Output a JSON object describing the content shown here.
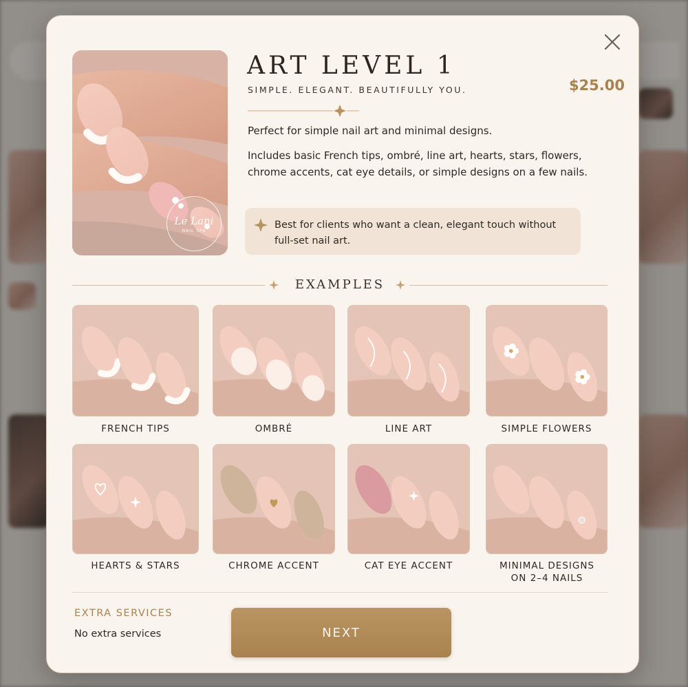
{
  "colors": {
    "accent_gold": "#a9834f",
    "modal_bg": "#faf4ee",
    "note_bg": "#f1e4d6",
    "text_dark": "#2e2823"
  },
  "modal": {
    "close_icon": "close-icon",
    "hero_logo": {
      "name": "Le Lani",
      "sub": "NAIL SPA"
    },
    "title": "ART LEVEL 1",
    "tagline": "SIMPLE. ELEGANT. BEAUTIFULLY YOU.",
    "price": "$25.00",
    "description_short": "Perfect for simple nail art and minimal designs.",
    "description_long": "Includes basic French tips, ombré, line art, hearts, stars, flowers, chrome accents, cat eye details, or simple designs on a few nails.",
    "note": {
      "icon": "sparkle-icon",
      "text": "Best for clients who want a clean, elegant touch without full-set nail art."
    },
    "examples_heading": "EXAMPLES",
    "examples": [
      {
        "label": "FRENCH TIPS",
        "style": "french"
      },
      {
        "label": "OMBRÉ",
        "style": "ombre"
      },
      {
        "label": "LINE ART",
        "style": "lineart"
      },
      {
        "label": "SIMPLE FLOWERS",
        "style": "flowers"
      },
      {
        "label": "HEARTS & STARS",
        "style": "hearts"
      },
      {
        "label": "CHROME ACCENT",
        "style": "chrome"
      },
      {
        "label": "CAT EYE ACCENT",
        "style": "cateye"
      },
      {
        "label": "MINIMAL DESIGNS ON 2–4 NAILS",
        "style": "minimal"
      }
    ],
    "extra_services": {
      "title": "EXTRA SERVICES",
      "value": "No extra services"
    },
    "next_label": "NEXT"
  }
}
